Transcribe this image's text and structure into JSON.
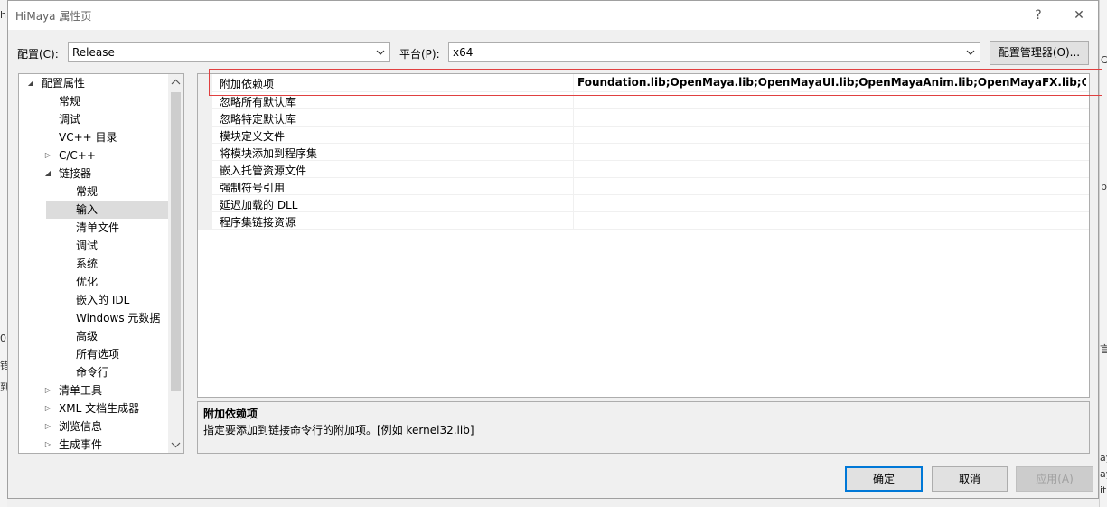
{
  "window": {
    "title": "HiMaya 属性页",
    "help": "?",
    "close": "✕"
  },
  "toolbar": {
    "config_label": "配置(C):",
    "config_value": "Release",
    "platform_label": "平台(P):",
    "platform_value": "x64",
    "config_manager_label": "配置管理器(O)..."
  },
  "tree": {
    "items": [
      {
        "label": "配置属性",
        "expander": "◢"
      },
      {
        "label": "常规"
      },
      {
        "label": "调试"
      },
      {
        "label": "VC++ 目录"
      },
      {
        "label": "C/C++",
        "expander": "▷"
      },
      {
        "label": "链接器",
        "expander": "◢"
      },
      {
        "label": "常规"
      },
      {
        "label": "输入"
      },
      {
        "label": "清单文件"
      },
      {
        "label": "调试"
      },
      {
        "label": "系统"
      },
      {
        "label": "优化"
      },
      {
        "label": "嵌入的 IDL"
      },
      {
        "label": "Windows 元数据"
      },
      {
        "label": "高级"
      },
      {
        "label": "所有选项"
      },
      {
        "label": "命令行"
      },
      {
        "label": "清单工具",
        "expander": "▷"
      },
      {
        "label": "XML 文档生成器",
        "expander": "▷"
      },
      {
        "label": "浏览信息",
        "expander": "▷"
      },
      {
        "label": "生成事件",
        "expander": "▷"
      }
    ]
  },
  "grid": {
    "rows": [
      {
        "name": "附加依赖项",
        "value": "Foundation.lib;OpenMaya.lib;OpenMayaUI.lib;OpenMayaAnim.lib;OpenMayaFX.lib;OpenMaya"
      },
      {
        "name": "忽略所有默认库",
        "value": ""
      },
      {
        "name": "忽略特定默认库",
        "value": ""
      },
      {
        "name": "模块定义文件",
        "value": ""
      },
      {
        "name": "将模块添加到程序集",
        "value": ""
      },
      {
        "name": "嵌入托管资源文件",
        "value": ""
      },
      {
        "name": "强制符号引用",
        "value": ""
      },
      {
        "name": "延迟加载的 DLL",
        "value": ""
      },
      {
        "name": "程序集链接资源",
        "value": ""
      }
    ]
  },
  "description": {
    "title": "附加依赖项",
    "text": "指定要添加到链接命令行的附加项。[例如 kernel32.lib]"
  },
  "buttons": {
    "ok": "确定",
    "cancel": "取消",
    "apply": "应用(A)"
  },
  "background_fragments": {
    "left": [
      "hi",
      "0",
      "错",
      "到"
    ],
    "right": [
      "C",
      "p",
      "言",
      "ay",
      "ay",
      "it"
    ]
  }
}
